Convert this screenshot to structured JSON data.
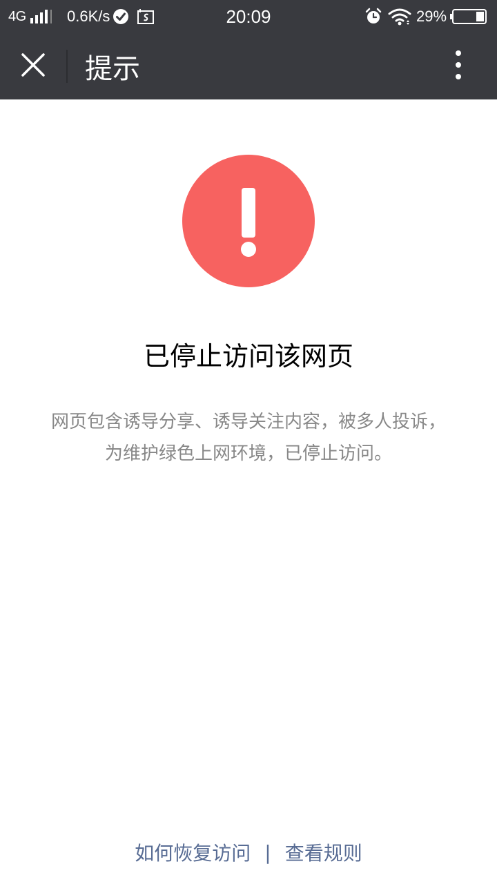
{
  "status_bar": {
    "network": "4G",
    "speed": "0.6K/s",
    "time": "20:09",
    "battery": "29%",
    "icons": [
      "signal-icon",
      "check-circle-icon",
      "screenshot-icon",
      "alarm-icon",
      "wifi-icon",
      "battery-icon"
    ]
  },
  "header": {
    "title": "提示",
    "close_icon": "close-icon",
    "more_icon": "more-vertical-icon",
    "background": "#393a3f"
  },
  "main": {
    "icon": "warning-icon",
    "icon_color": "#f76260",
    "title": "已停止访问该网页",
    "description_line1": "网页包含诱导分享、诱导关注内容，被多人投诉，",
    "description_line2": "为维护绿色上网环境，已停止访问。"
  },
  "footer": {
    "recover_link": "如何恢复访问",
    "separator": "|",
    "rules_link": "查看规则",
    "link_color": "#586c94"
  }
}
